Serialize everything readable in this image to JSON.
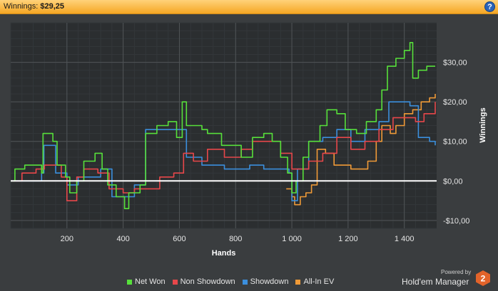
{
  "header": {
    "label": "Winnings:",
    "value": "$29,25",
    "help_glyph": "?"
  },
  "footer": {
    "powered_by": "Powered by",
    "brand": "Hold'em Manager",
    "logo_text": "2"
  },
  "colors": {
    "Net Won": "#57e03b",
    "Non Showdown": "#e8474a",
    "Showdown": "#3b8fdd",
    "All-In EV": "#f09a37",
    "zero_line": "#ffffff"
  },
  "chart_data": {
    "type": "line",
    "title": "",
    "xlabel": "Hands",
    "ylabel": "Winnings",
    "xlim": [
      0,
      1515
    ],
    "ylim": [
      -12,
      40
    ],
    "x_ticks": [
      200,
      400,
      600,
      800,
      1000,
      1200,
      1400
    ],
    "x_tick_labels": [
      "200",
      "400",
      "600",
      "800",
      "1 000",
      "1 200",
      "1 400"
    ],
    "y_ticks": [
      -10,
      0,
      10,
      20,
      30
    ],
    "y_tick_labels": [
      "-$10,00",
      "$0,00",
      "$10,00",
      "$20,00",
      "$30,00"
    ],
    "grid": true,
    "legend_position": "bottom",
    "series": [
      {
        "name": "Net Won",
        "points": [
          [
            0,
            0
          ],
          [
            15,
            3
          ],
          [
            50,
            4
          ],
          [
            110,
            2
          ],
          [
            115,
            12
          ],
          [
            150,
            10
          ],
          [
            165,
            4
          ],
          [
            195,
            1
          ],
          [
            210,
            -3
          ],
          [
            235,
            0
          ],
          [
            260,
            5
          ],
          [
            300,
            7
          ],
          [
            325,
            3
          ],
          [
            345,
            -1
          ],
          [
            375,
            -4
          ],
          [
            405,
            -7
          ],
          [
            420,
            -3
          ],
          [
            460,
            -1
          ],
          [
            480,
            12
          ],
          [
            520,
            14
          ],
          [
            560,
            15
          ],
          [
            590,
            11
          ],
          [
            610,
            20
          ],
          [
            625,
            14
          ],
          [
            680,
            13
          ],
          [
            700,
            12
          ],
          [
            750,
            9
          ],
          [
            800,
            9
          ],
          [
            820,
            6
          ],
          [
            860,
            11
          ],
          [
            900,
            12
          ],
          [
            930,
            10
          ],
          [
            960,
            6
          ],
          [
            985,
            2
          ],
          [
            1000,
            -3
          ],
          [
            1015,
            0
          ],
          [
            1040,
            6
          ],
          [
            1060,
            10
          ],
          [
            1100,
            14
          ],
          [
            1125,
            18
          ],
          [
            1160,
            17
          ],
          [
            1190,
            13
          ],
          [
            1230,
            12
          ],
          [
            1265,
            15
          ],
          [
            1300,
            18
          ],
          [
            1320,
            23
          ],
          [
            1340,
            29
          ],
          [
            1370,
            31
          ],
          [
            1400,
            33
          ],
          [
            1420,
            35
          ],
          [
            1430,
            26
          ],
          [
            1450,
            28
          ],
          [
            1480,
            29
          ],
          [
            1510,
            29
          ]
        ]
      },
      {
        "name": "Non Showdown",
        "points": [
          [
            0,
            0
          ],
          [
            40,
            2
          ],
          [
            90,
            3
          ],
          [
            120,
            4
          ],
          [
            180,
            1
          ],
          [
            200,
            -5
          ],
          [
            235,
            1
          ],
          [
            260,
            3
          ],
          [
            310,
            2
          ],
          [
            350,
            -2
          ],
          [
            400,
            -3
          ],
          [
            440,
            -2
          ],
          [
            480,
            -2
          ],
          [
            530,
            1
          ],
          [
            580,
            2
          ],
          [
            615,
            7
          ],
          [
            650,
            5
          ],
          [
            700,
            8
          ],
          [
            760,
            6
          ],
          [
            820,
            8
          ],
          [
            860,
            10
          ],
          [
            920,
            10
          ],
          [
            960,
            7
          ],
          [
            1000,
            3
          ],
          [
            1060,
            5
          ],
          [
            1110,
            7
          ],
          [
            1160,
            11
          ],
          [
            1210,
            8
          ],
          [
            1260,
            10
          ],
          [
            1310,
            13
          ],
          [
            1360,
            16
          ],
          [
            1400,
            16
          ],
          [
            1440,
            15
          ],
          [
            1470,
            17
          ],
          [
            1510,
            20
          ]
        ]
      },
      {
        "name": "Showdown",
        "points": [
          [
            0,
            0
          ],
          [
            40,
            0
          ],
          [
            80,
            0
          ],
          [
            110,
            2
          ],
          [
            118,
            9
          ],
          [
            160,
            2
          ],
          [
            200,
            -1
          ],
          [
            240,
            1
          ],
          [
            290,
            1
          ],
          [
            320,
            3
          ],
          [
            360,
            -4
          ],
          [
            400,
            -4
          ],
          [
            440,
            -1
          ],
          [
            480,
            13
          ],
          [
            520,
            13
          ],
          [
            560,
            13
          ],
          [
            590,
            13
          ],
          [
            625,
            6
          ],
          [
            680,
            4
          ],
          [
            720,
            4
          ],
          [
            760,
            3
          ],
          [
            800,
            3
          ],
          [
            850,
            4
          ],
          [
            900,
            3
          ],
          [
            960,
            3
          ],
          [
            990,
            2
          ],
          [
            1000,
            -5
          ],
          [
            1020,
            3
          ],
          [
            1060,
            10
          ],
          [
            1110,
            11
          ],
          [
            1160,
            13
          ],
          [
            1210,
            10
          ],
          [
            1260,
            13
          ],
          [
            1310,
            15
          ],
          [
            1345,
            20
          ],
          [
            1380,
            20
          ],
          [
            1420,
            19
          ],
          [
            1450,
            11
          ],
          [
            1490,
            10
          ],
          [
            1510,
            9
          ]
        ]
      },
      {
        "name": "All-In EV",
        "points": [
          [
            980,
            -2
          ],
          [
            1000,
            -4
          ],
          [
            1010,
            -6
          ],
          [
            1030,
            -4
          ],
          [
            1050,
            -3
          ],
          [
            1070,
            -1
          ],
          [
            1090,
            8
          ],
          [
            1120,
            7
          ],
          [
            1150,
            4
          ],
          [
            1180,
            4
          ],
          [
            1210,
            3
          ],
          [
            1240,
            3
          ],
          [
            1270,
            5
          ],
          [
            1300,
            10
          ],
          [
            1320,
            14
          ],
          [
            1350,
            12
          ],
          [
            1370,
            14
          ],
          [
            1400,
            17
          ],
          [
            1430,
            18
          ],
          [
            1460,
            20
          ],
          [
            1490,
            21
          ],
          [
            1510,
            22
          ]
        ]
      }
    ]
  }
}
